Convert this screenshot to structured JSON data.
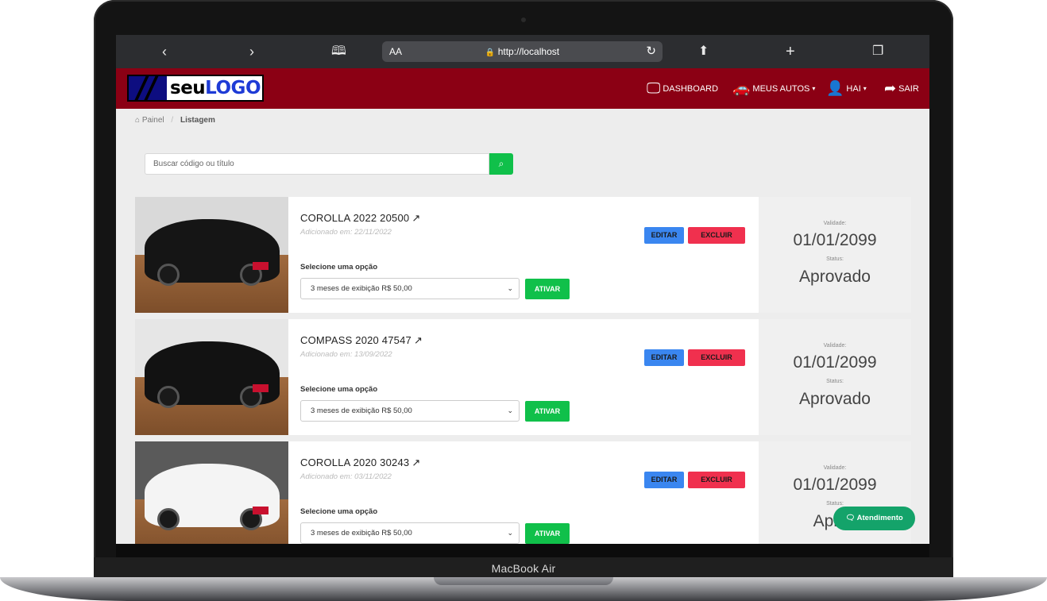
{
  "device": {
    "label": "MacBook Air"
  },
  "browser": {
    "text_size": "AA",
    "url": "http://localhost"
  },
  "header": {
    "logo": {
      "part1": "seu",
      "part2": "LOGO"
    },
    "nav": [
      {
        "label": "DASHBOARD",
        "icon": "monitor-icon"
      },
      {
        "label": "MEUS AUTOS",
        "icon": "car-icon"
      },
      {
        "label": "HAI",
        "icon": "user-icon"
      },
      {
        "label": "SAIR",
        "icon": "sign-out-icon"
      }
    ]
  },
  "breadcrumb": {
    "home": "Painel",
    "current": "Listagem"
  },
  "search": {
    "placeholder": "Buscar código ou título"
  },
  "labels": {
    "select_label": "Selecione uma opção",
    "activate": "ATIVAR",
    "edit": "EDITAR",
    "delete": "EXCLUIR",
    "validity_label": "Validade:",
    "status_label": "Status:"
  },
  "listings": [
    {
      "title": "COROLLA 2022 20500",
      "added": "Adicionado em: 22/11/2022",
      "option": "3 meses de exibição R$ 50,00",
      "validity": "01/01/2099",
      "status": "Aprovado",
      "car_color": "#151515",
      "wall_color": "#d9d9d9"
    },
    {
      "title": "COMPASS 2020 47547",
      "added": "Adicionado em: 13/09/2022",
      "option": "3 meses de exibição R$ 50,00",
      "validity": "01/01/2099",
      "status": "Aprovado",
      "car_color": "#121212",
      "wall_color": "#e6e6e6"
    },
    {
      "title": "COROLLA 2020 30243",
      "added": "Adicionado em: 03/11/2022",
      "option": "3 meses de exibição R$ 50,00",
      "validity": "01/01/2099",
      "status": "Aprov",
      "car_color": "#f4f4f4",
      "wall_color": "#5a5a5a"
    }
  ],
  "chat": {
    "label": "Atendimento"
  }
}
